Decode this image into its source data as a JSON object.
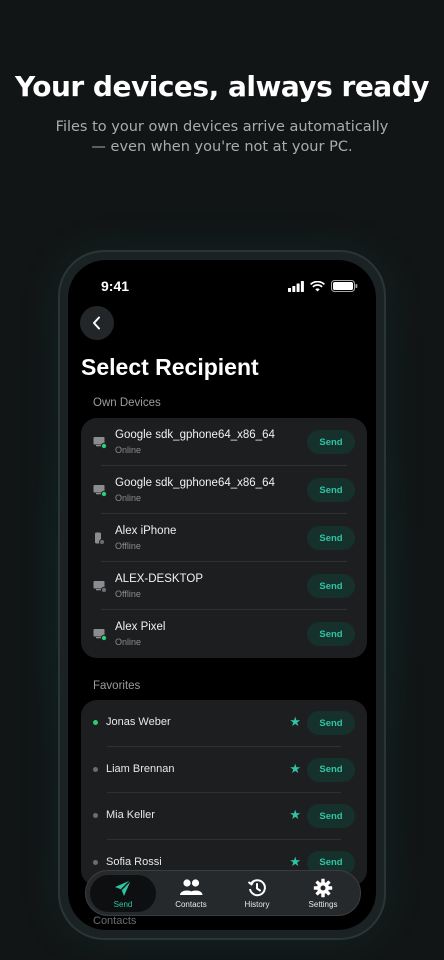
{
  "hero": {
    "title": "Your devices, always ready",
    "subtitle_line1": "Files to your own devices arrive automatically",
    "subtitle_line2": "— even when you're not at your PC."
  },
  "status_bar": {
    "time": "9:41"
  },
  "page": {
    "title": "Select Recipient"
  },
  "own_devices": {
    "label": "Own Devices",
    "items": [
      {
        "name": "Google sdk_gphone64_x86_64",
        "status": "Online",
        "type": "desktop",
        "online": true,
        "action": "Send"
      },
      {
        "name": "Google sdk_gphone64_x86_64",
        "status": "Online",
        "type": "desktop",
        "online": true,
        "action": "Send"
      },
      {
        "name": "Alex iPhone",
        "status": "Offline",
        "type": "phone",
        "online": false,
        "action": "Send"
      },
      {
        "name": "ALEX-DESKTOP",
        "status": "Offline",
        "type": "desktop",
        "online": false,
        "action": "Send"
      },
      {
        "name": "Alex Pixel",
        "status": "Online",
        "type": "desktop",
        "online": true,
        "action": "Send"
      }
    ]
  },
  "favorites": {
    "label": "Favorites",
    "items": [
      {
        "name": "Jonas Weber",
        "online": true,
        "action": "Send"
      },
      {
        "name": "Liam Brennan",
        "online": false,
        "action": "Send"
      },
      {
        "name": "Mia Keller",
        "online": false,
        "action": "Send"
      },
      {
        "name": "Sofia Rossi",
        "online": false,
        "action": "Send"
      }
    ]
  },
  "contacts_peek": "Contacts",
  "tabbar": {
    "items": [
      {
        "label": "Send",
        "icon": "send-icon",
        "active": true
      },
      {
        "label": "Contacts",
        "icon": "contacts-icon",
        "active": false
      },
      {
        "label": "History",
        "icon": "history-icon",
        "active": false
      },
      {
        "label": "Settings",
        "icon": "settings-icon",
        "active": false
      }
    ]
  },
  "colors": {
    "accent": "#2fc5a4",
    "online": "#2ecc71",
    "offline": "#6b6e70",
    "card": "#1d1e20",
    "send_button_bg": "#16302c"
  }
}
